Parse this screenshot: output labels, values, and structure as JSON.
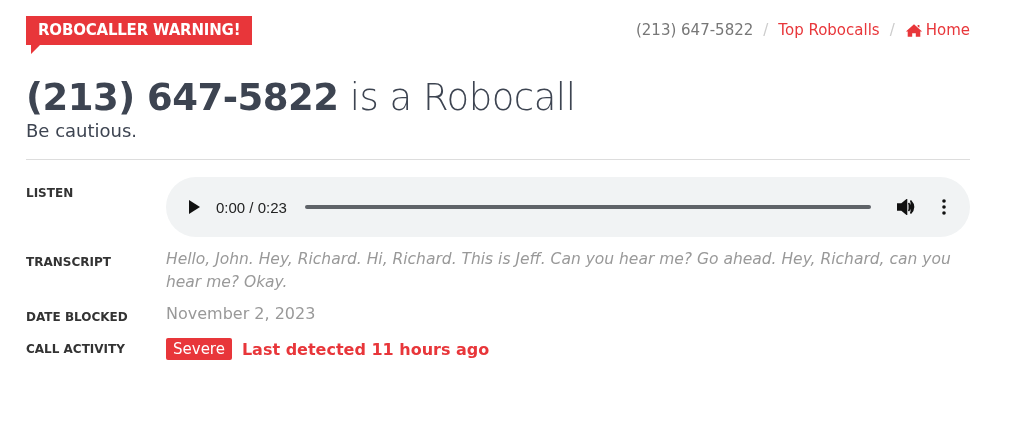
{
  "banner": {
    "label": "ROBOCALLER WARNING!"
  },
  "breadcrumbs": [
    {
      "label": "(213) 647-5822",
      "kind": "current"
    },
    {
      "label": "Top Robocalls",
      "kind": "link",
      "separator": "/"
    },
    {
      "label": "Home",
      "kind": "home",
      "separator": "/"
    }
  ],
  "heading": "**(213) 647-5822** is a Robocall",
  "subheading": "Be cautious.",
  "details": [
    {
      "label": "LISTEN",
      "kind": "audio",
      "time": "0:00 / 0:23"
    },
    {
      "label": "TRANSCRIPT",
      "kind": "transcript",
      "text": "Hello, John. Hey, Richard. Hi, Richard. This is Jeff. Can you hear me? Go ahead. Hey, Richard, can you hear me? Okay."
    },
    {
      "label": "DATE BLOCKED",
      "kind": "date",
      "text": "November 2, 2023"
    },
    {
      "label": "CALL ACTIVITY",
      "kind": "activity",
      "badge": "Severe",
      "text": "Last detected 11 hours ago"
    }
  ]
}
